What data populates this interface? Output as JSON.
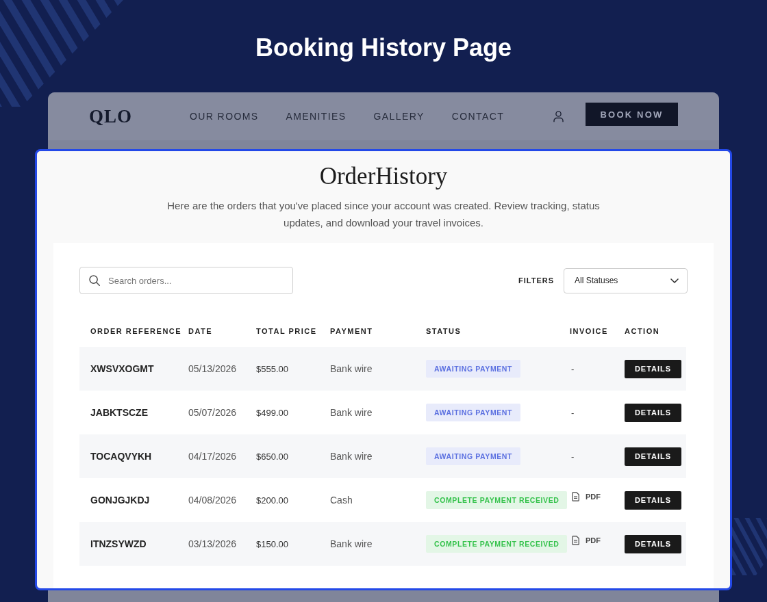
{
  "page_title": "Booking History Page",
  "site_header": {
    "logo": "QLO",
    "nav": [
      "OUR ROOMS",
      "AMENITIES",
      "GALLERY",
      "CONTACT"
    ],
    "book_button": "BOOK NOW"
  },
  "order_history": {
    "title": "OrderHistory",
    "description": "Here are the orders that you've placed since your account was created. Review tracking, status updates, and download your travel invoices.",
    "search": {
      "placeholder": "Search orders..."
    },
    "filters": {
      "label": "FILTERS",
      "value": "All Statuses"
    },
    "table": {
      "columns": [
        "ORDER REFERENCE",
        "DATE",
        "TOTAL PRICE",
        "PAYMENT",
        "STATUS",
        "INVOICE",
        "ACTION"
      ],
      "rows": [
        {
          "reference": "XWSVXOGMT",
          "date": "05/13/2026",
          "total": "$555.00",
          "payment": "Bank wire",
          "status": {
            "label": "AWAITING PAYMENT",
            "color": "#5a6fe0"
          },
          "invoice": {
            "kind": "none",
            "label": "-"
          },
          "action": "DETAILS"
        },
        {
          "reference": "JABKTSCZE",
          "date": "05/07/2026",
          "total": "$499.00",
          "payment": "Bank wire",
          "status": {
            "label": "AWAITING PAYMENT",
            "color": "#5a6fe0"
          },
          "invoice": {
            "kind": "none",
            "label": "-"
          },
          "action": "DETAILS"
        },
        {
          "reference": "TOCAQVYKH",
          "date": "04/17/2026",
          "total": "$650.00",
          "payment": "Bank wire",
          "status": {
            "label": "AWAITING PAYMENT",
            "color": "#5a6fe0"
          },
          "invoice": {
            "kind": "none",
            "label": "-"
          },
          "action": "DETAILS"
        },
        {
          "reference": "GONJGJKDJ",
          "date": "04/08/2026",
          "total": "$200.00",
          "payment": "Cash",
          "status": {
            "label": "COMPLETE PAYMENT RECEIVED",
            "color": "#34c24b"
          },
          "invoice": {
            "kind": "pdf",
            "label": "PDF"
          },
          "action": "DETAILS"
        },
        {
          "reference": "ITNZSYWZD",
          "date": "03/13/2026",
          "total": "$150.00",
          "payment": "Bank wire",
          "status": {
            "label": "COMPLETE PAYMENT RECEIVED",
            "color": "#34c24b"
          },
          "invoice": {
            "kind": "pdf",
            "label": "PDF"
          },
          "action": "DETAILS"
        }
      ]
    }
  }
}
